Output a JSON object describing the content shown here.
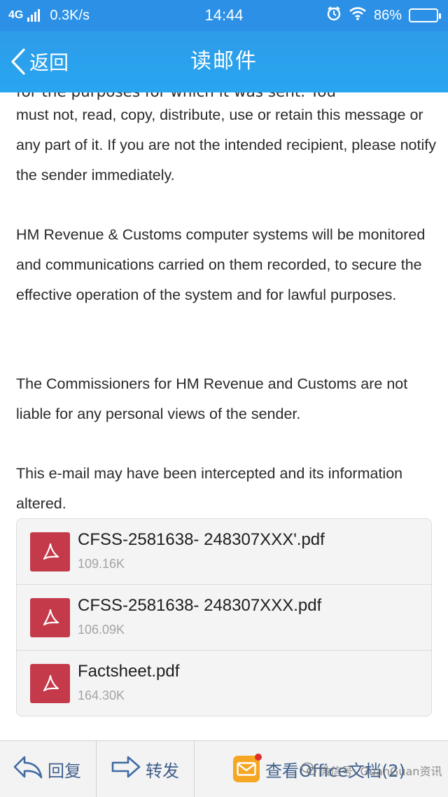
{
  "status_bar": {
    "network": "4G",
    "speed": "0.3K/s",
    "time": "14:44",
    "battery": "86%",
    "battery_level": 0.86,
    "icons": [
      "signal-icon",
      "alarm-icon",
      "wifi-icon",
      "battery-icon"
    ]
  },
  "header": {
    "back_label": "返回",
    "title": "读邮件",
    "color": "#2b90e6"
  },
  "email_body": {
    "partial_line": "for the purposes for which it was sent. You",
    "paragraphs": [
      "must not, read, copy, distribute, use or retain this message or any part of it. If you are not the intended recipient, please notify the sender immediately.",
      "HM Revenue & Customs computer systems will be monitored and communications carried on them recorded, to secure the effective operation of the system and for lawful purposes.",
      "The Commissioners for HM Revenue and Customs are not liable for any personal views of the sender.",
      "This e-mail may have been intercepted and its information altered."
    ]
  },
  "attachments": [
    {
      "name": "CFSS-2581638- 248307XXX'.pdf",
      "size": "109.16K",
      "icon": "pdf-icon"
    },
    {
      "name": "CFSS-2581638- 248307XXX.pdf",
      "size": "106.09K",
      "icon": "pdf-icon"
    },
    {
      "name": "Factsheet.pdf",
      "size": "164.30K",
      "icon": "pdf-icon"
    }
  ],
  "bottom_bar": {
    "reply_label": "回复",
    "forward_label": "转发",
    "office_label": "查看Office文档(2)"
  },
  "watermark": "微信号: GuanGuan资讯"
}
